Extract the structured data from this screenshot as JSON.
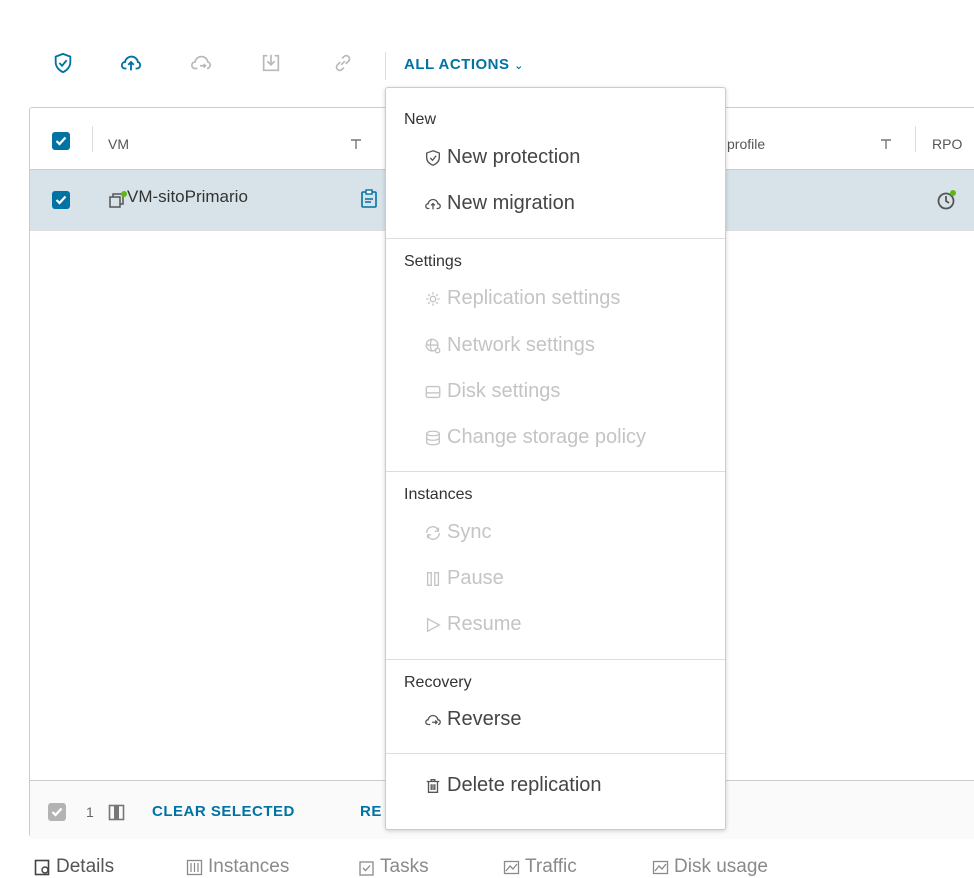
{
  "toolbar": {
    "icons": [
      "shield-check-icon",
      "cloud-upload-icon",
      "cloud-reverse-icon",
      "download-icon",
      "link-icon"
    ],
    "all_actions_label": "ALL ACTIONS",
    "accent_color": "#0072a3"
  },
  "grid": {
    "columns": {
      "vm": "VM",
      "profile": "profile",
      "rpo": "RPO"
    },
    "rows": [
      {
        "name": "VM-sitoPrimario",
        "selected": true
      }
    ],
    "footer": {
      "selected_count": "1",
      "clear_selected": "CLEAR SELECTED",
      "truncated_link": "RE"
    }
  },
  "menu": {
    "sections": [
      {
        "header": "New",
        "items": [
          {
            "label": "New protection",
            "icon": "shield-check-icon",
            "enabled": true
          },
          {
            "label": "New migration",
            "icon": "cloud-upload-icon",
            "enabled": true
          }
        ]
      },
      {
        "header": "Settings",
        "items": [
          {
            "label": "Replication settings",
            "icon": "gear-icon",
            "enabled": false
          },
          {
            "label": "Network settings",
            "icon": "network-gear-icon",
            "enabled": false
          },
          {
            "label": "Disk settings",
            "icon": "disk-icon",
            "enabled": false
          },
          {
            "label": "Change storage policy",
            "icon": "storage-icon",
            "enabled": false
          }
        ]
      },
      {
        "header": "Instances",
        "items": [
          {
            "label": "Sync",
            "icon": "sync-icon",
            "enabled": false
          },
          {
            "label": "Pause",
            "icon": "pause-icon",
            "enabled": false
          },
          {
            "label": "Resume",
            "icon": "play-icon",
            "enabled": false
          }
        ]
      },
      {
        "header": "Recovery",
        "items": [
          {
            "label": "Reverse",
            "icon": "cloud-reverse-icon",
            "enabled": true
          }
        ]
      },
      {
        "header": "",
        "items": [
          {
            "label": "Delete replication",
            "icon": "trash-icon",
            "enabled": true
          }
        ]
      }
    ]
  },
  "bottom_tabs": [
    {
      "label": "Details",
      "icon": "details-icon"
    },
    {
      "label": "Instances",
      "icon": "instances-icon"
    },
    {
      "label": "Tasks",
      "icon": "tasks-icon"
    },
    {
      "label": "Traffic",
      "icon": "chart-icon"
    },
    {
      "label": "Disk usage",
      "icon": "chart-icon"
    }
  ]
}
